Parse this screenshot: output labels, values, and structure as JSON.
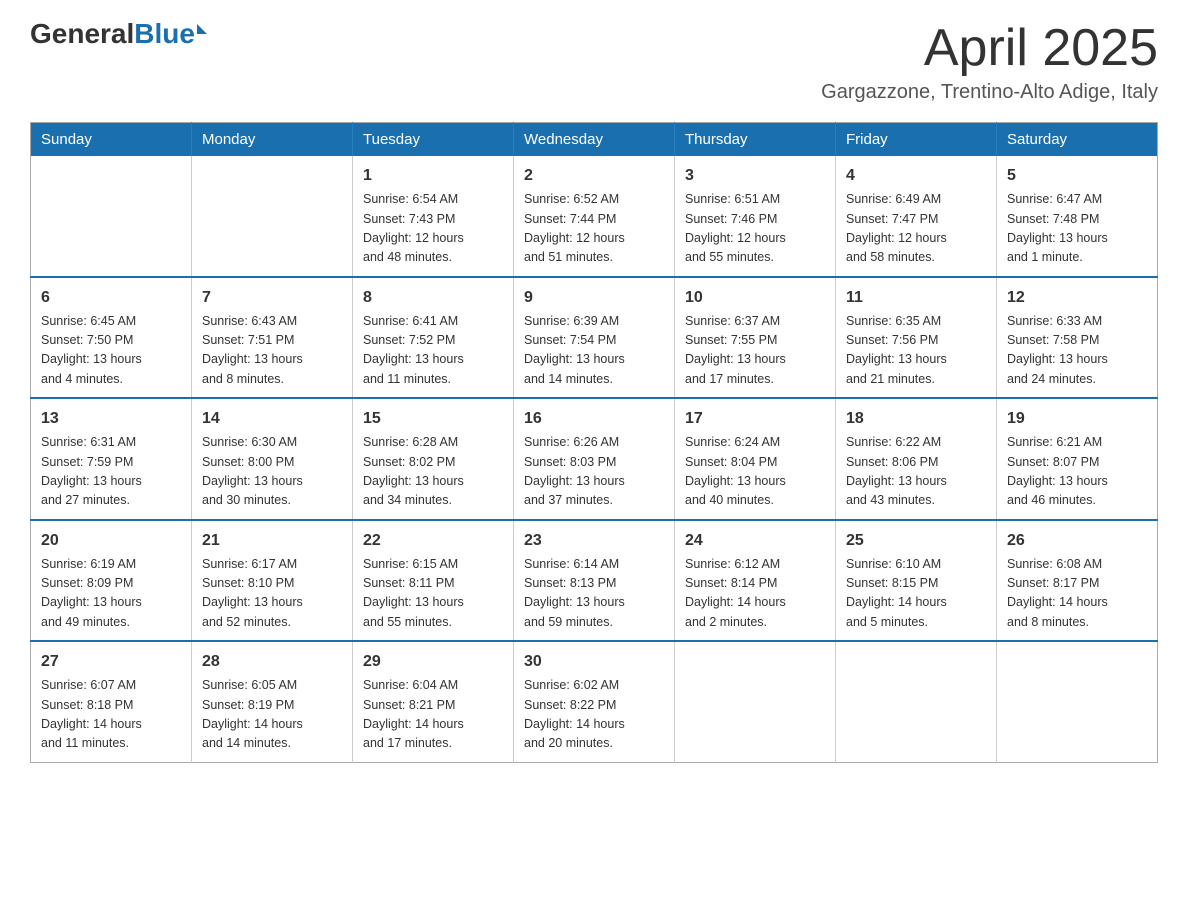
{
  "header": {
    "logo_general": "General",
    "logo_blue": "Blue",
    "title": "April 2025",
    "subtitle": "Gargazzone, Trentino-Alto Adige, Italy"
  },
  "calendar": {
    "days_of_week": [
      "Sunday",
      "Monday",
      "Tuesday",
      "Wednesday",
      "Thursday",
      "Friday",
      "Saturday"
    ],
    "weeks": [
      [
        {
          "day": "",
          "info": ""
        },
        {
          "day": "",
          "info": ""
        },
        {
          "day": "1",
          "info": "Sunrise: 6:54 AM\nSunset: 7:43 PM\nDaylight: 12 hours\nand 48 minutes."
        },
        {
          "day": "2",
          "info": "Sunrise: 6:52 AM\nSunset: 7:44 PM\nDaylight: 12 hours\nand 51 minutes."
        },
        {
          "day": "3",
          "info": "Sunrise: 6:51 AM\nSunset: 7:46 PM\nDaylight: 12 hours\nand 55 minutes."
        },
        {
          "day": "4",
          "info": "Sunrise: 6:49 AM\nSunset: 7:47 PM\nDaylight: 12 hours\nand 58 minutes."
        },
        {
          "day": "5",
          "info": "Sunrise: 6:47 AM\nSunset: 7:48 PM\nDaylight: 13 hours\nand 1 minute."
        }
      ],
      [
        {
          "day": "6",
          "info": "Sunrise: 6:45 AM\nSunset: 7:50 PM\nDaylight: 13 hours\nand 4 minutes."
        },
        {
          "day": "7",
          "info": "Sunrise: 6:43 AM\nSunset: 7:51 PM\nDaylight: 13 hours\nand 8 minutes."
        },
        {
          "day": "8",
          "info": "Sunrise: 6:41 AM\nSunset: 7:52 PM\nDaylight: 13 hours\nand 11 minutes."
        },
        {
          "day": "9",
          "info": "Sunrise: 6:39 AM\nSunset: 7:54 PM\nDaylight: 13 hours\nand 14 minutes."
        },
        {
          "day": "10",
          "info": "Sunrise: 6:37 AM\nSunset: 7:55 PM\nDaylight: 13 hours\nand 17 minutes."
        },
        {
          "day": "11",
          "info": "Sunrise: 6:35 AM\nSunset: 7:56 PM\nDaylight: 13 hours\nand 21 minutes."
        },
        {
          "day": "12",
          "info": "Sunrise: 6:33 AM\nSunset: 7:58 PM\nDaylight: 13 hours\nand 24 minutes."
        }
      ],
      [
        {
          "day": "13",
          "info": "Sunrise: 6:31 AM\nSunset: 7:59 PM\nDaylight: 13 hours\nand 27 minutes."
        },
        {
          "day": "14",
          "info": "Sunrise: 6:30 AM\nSunset: 8:00 PM\nDaylight: 13 hours\nand 30 minutes."
        },
        {
          "day": "15",
          "info": "Sunrise: 6:28 AM\nSunset: 8:02 PM\nDaylight: 13 hours\nand 34 minutes."
        },
        {
          "day": "16",
          "info": "Sunrise: 6:26 AM\nSunset: 8:03 PM\nDaylight: 13 hours\nand 37 minutes."
        },
        {
          "day": "17",
          "info": "Sunrise: 6:24 AM\nSunset: 8:04 PM\nDaylight: 13 hours\nand 40 minutes."
        },
        {
          "day": "18",
          "info": "Sunrise: 6:22 AM\nSunset: 8:06 PM\nDaylight: 13 hours\nand 43 minutes."
        },
        {
          "day": "19",
          "info": "Sunrise: 6:21 AM\nSunset: 8:07 PM\nDaylight: 13 hours\nand 46 minutes."
        }
      ],
      [
        {
          "day": "20",
          "info": "Sunrise: 6:19 AM\nSunset: 8:09 PM\nDaylight: 13 hours\nand 49 minutes."
        },
        {
          "day": "21",
          "info": "Sunrise: 6:17 AM\nSunset: 8:10 PM\nDaylight: 13 hours\nand 52 minutes."
        },
        {
          "day": "22",
          "info": "Sunrise: 6:15 AM\nSunset: 8:11 PM\nDaylight: 13 hours\nand 55 minutes."
        },
        {
          "day": "23",
          "info": "Sunrise: 6:14 AM\nSunset: 8:13 PM\nDaylight: 13 hours\nand 59 minutes."
        },
        {
          "day": "24",
          "info": "Sunrise: 6:12 AM\nSunset: 8:14 PM\nDaylight: 14 hours\nand 2 minutes."
        },
        {
          "day": "25",
          "info": "Sunrise: 6:10 AM\nSunset: 8:15 PM\nDaylight: 14 hours\nand 5 minutes."
        },
        {
          "day": "26",
          "info": "Sunrise: 6:08 AM\nSunset: 8:17 PM\nDaylight: 14 hours\nand 8 minutes."
        }
      ],
      [
        {
          "day": "27",
          "info": "Sunrise: 6:07 AM\nSunset: 8:18 PM\nDaylight: 14 hours\nand 11 minutes."
        },
        {
          "day": "28",
          "info": "Sunrise: 6:05 AM\nSunset: 8:19 PM\nDaylight: 14 hours\nand 14 minutes."
        },
        {
          "day": "29",
          "info": "Sunrise: 6:04 AM\nSunset: 8:21 PM\nDaylight: 14 hours\nand 17 minutes."
        },
        {
          "day": "30",
          "info": "Sunrise: 6:02 AM\nSunset: 8:22 PM\nDaylight: 14 hours\nand 20 minutes."
        },
        {
          "day": "",
          "info": ""
        },
        {
          "day": "",
          "info": ""
        },
        {
          "day": "",
          "info": ""
        }
      ]
    ]
  }
}
